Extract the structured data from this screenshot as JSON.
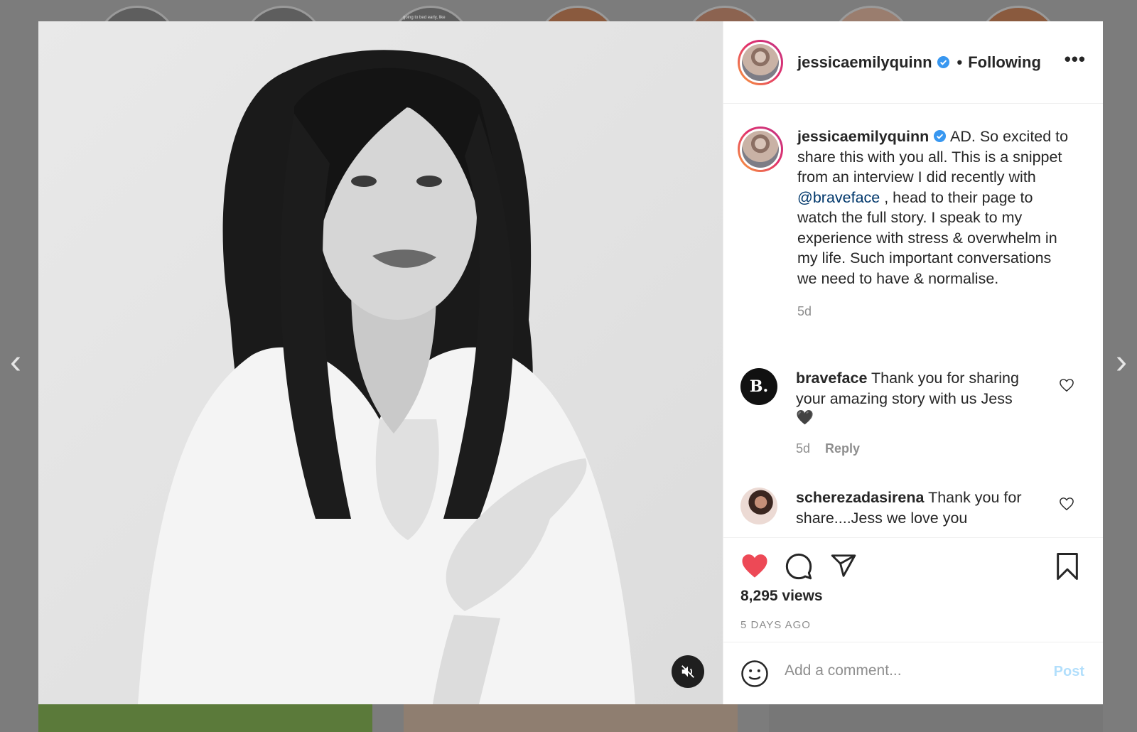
{
  "background": {
    "story_snippet": "going to bed early, like",
    "prev_arrow": "‹",
    "next_arrow": "›"
  },
  "post": {
    "author": {
      "username": "jessicaemilyquinn",
      "verified": true,
      "separator": "•",
      "follow_status": "Following"
    },
    "more_icon": "•••",
    "caption": {
      "username": "jessicaemilyquinn",
      "text_before": " AD. So excited to share this with you all. This is a snippet from an interview I did recently with ",
      "mention": "@braveface",
      "text_after": " , head to their page to watch the full story. I speak to my experience with stress & overwhelm in my life. Such important conversations we need to have & normalise.",
      "time": "5d"
    },
    "comments": [
      {
        "username": "braveface",
        "avatar_text": "B.",
        "text": " Thank you for sharing your amazing story with us Jess",
        "emoji": "🖤",
        "time": "5d",
        "reply_label": "Reply"
      },
      {
        "username": "scherezadasirena",
        "text": " Thank you for share....Jess we love you"
      }
    ],
    "stats": {
      "views": "8,295 views",
      "posted": "5 DAYS AGO"
    },
    "add_comment": {
      "placeholder": "Add a comment...",
      "post_label": "Post"
    }
  },
  "colors": {
    "like_red": "#ed4956",
    "mention_blue": "#00376b",
    "verified_blue": "#3897f0",
    "post_disabled": "#b2dffc"
  },
  "icons": [
    "heart-filled-icon",
    "comment-icon",
    "share-icon",
    "bookmark-icon",
    "emoji-icon",
    "muted-speaker-icon",
    "heart-outline-icon",
    "verified-badge-icon"
  ]
}
